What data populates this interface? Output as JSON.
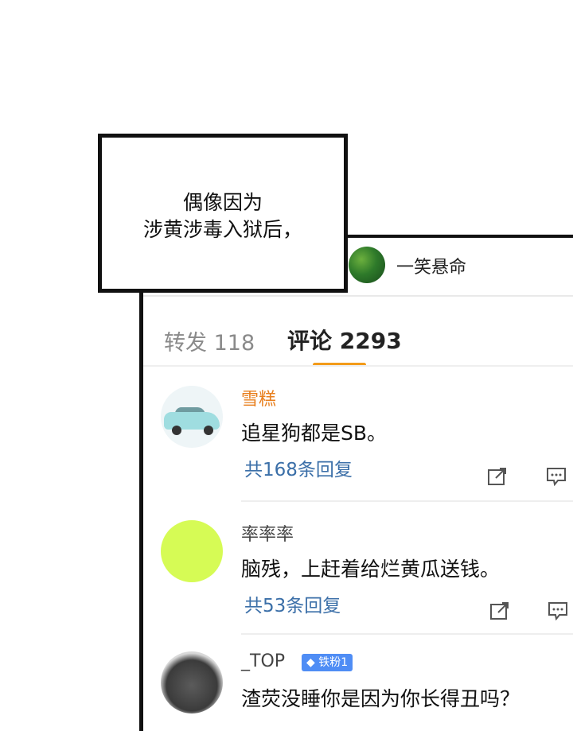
{
  "caption": {
    "line1": "偶像因为",
    "line2": "涉黄涉毒入狱后，"
  },
  "post": {
    "author_name": "一笑悬命"
  },
  "tabs": {
    "repost_label": "转发",
    "repost_count": "118",
    "comments_label": "评论",
    "comments_count": "2293",
    "active": "comments"
  },
  "comments": [
    {
      "username": "雪糕",
      "text": "追星狗都是SB。",
      "replies": "共168条回复",
      "avatar": "car"
    },
    {
      "username": "率率率",
      "text": "脑残，上赶着给烂黄瓜送钱。",
      "replies": "共53条回复",
      "avatar": "lime"
    },
    {
      "username": "_TOP",
      "badge": "铁粉1",
      "text": "渣荧没睡你是因为你长得丑吗？",
      "avatar": "rabbit"
    }
  ],
  "colors": {
    "accent": "#f39b1a",
    "username_highlight": "#e87f1e",
    "reply_link": "#3b6fa8",
    "badge": "#4f8df5"
  },
  "icons": [
    "share-icon",
    "comment-icon",
    "diamond-icon"
  ]
}
